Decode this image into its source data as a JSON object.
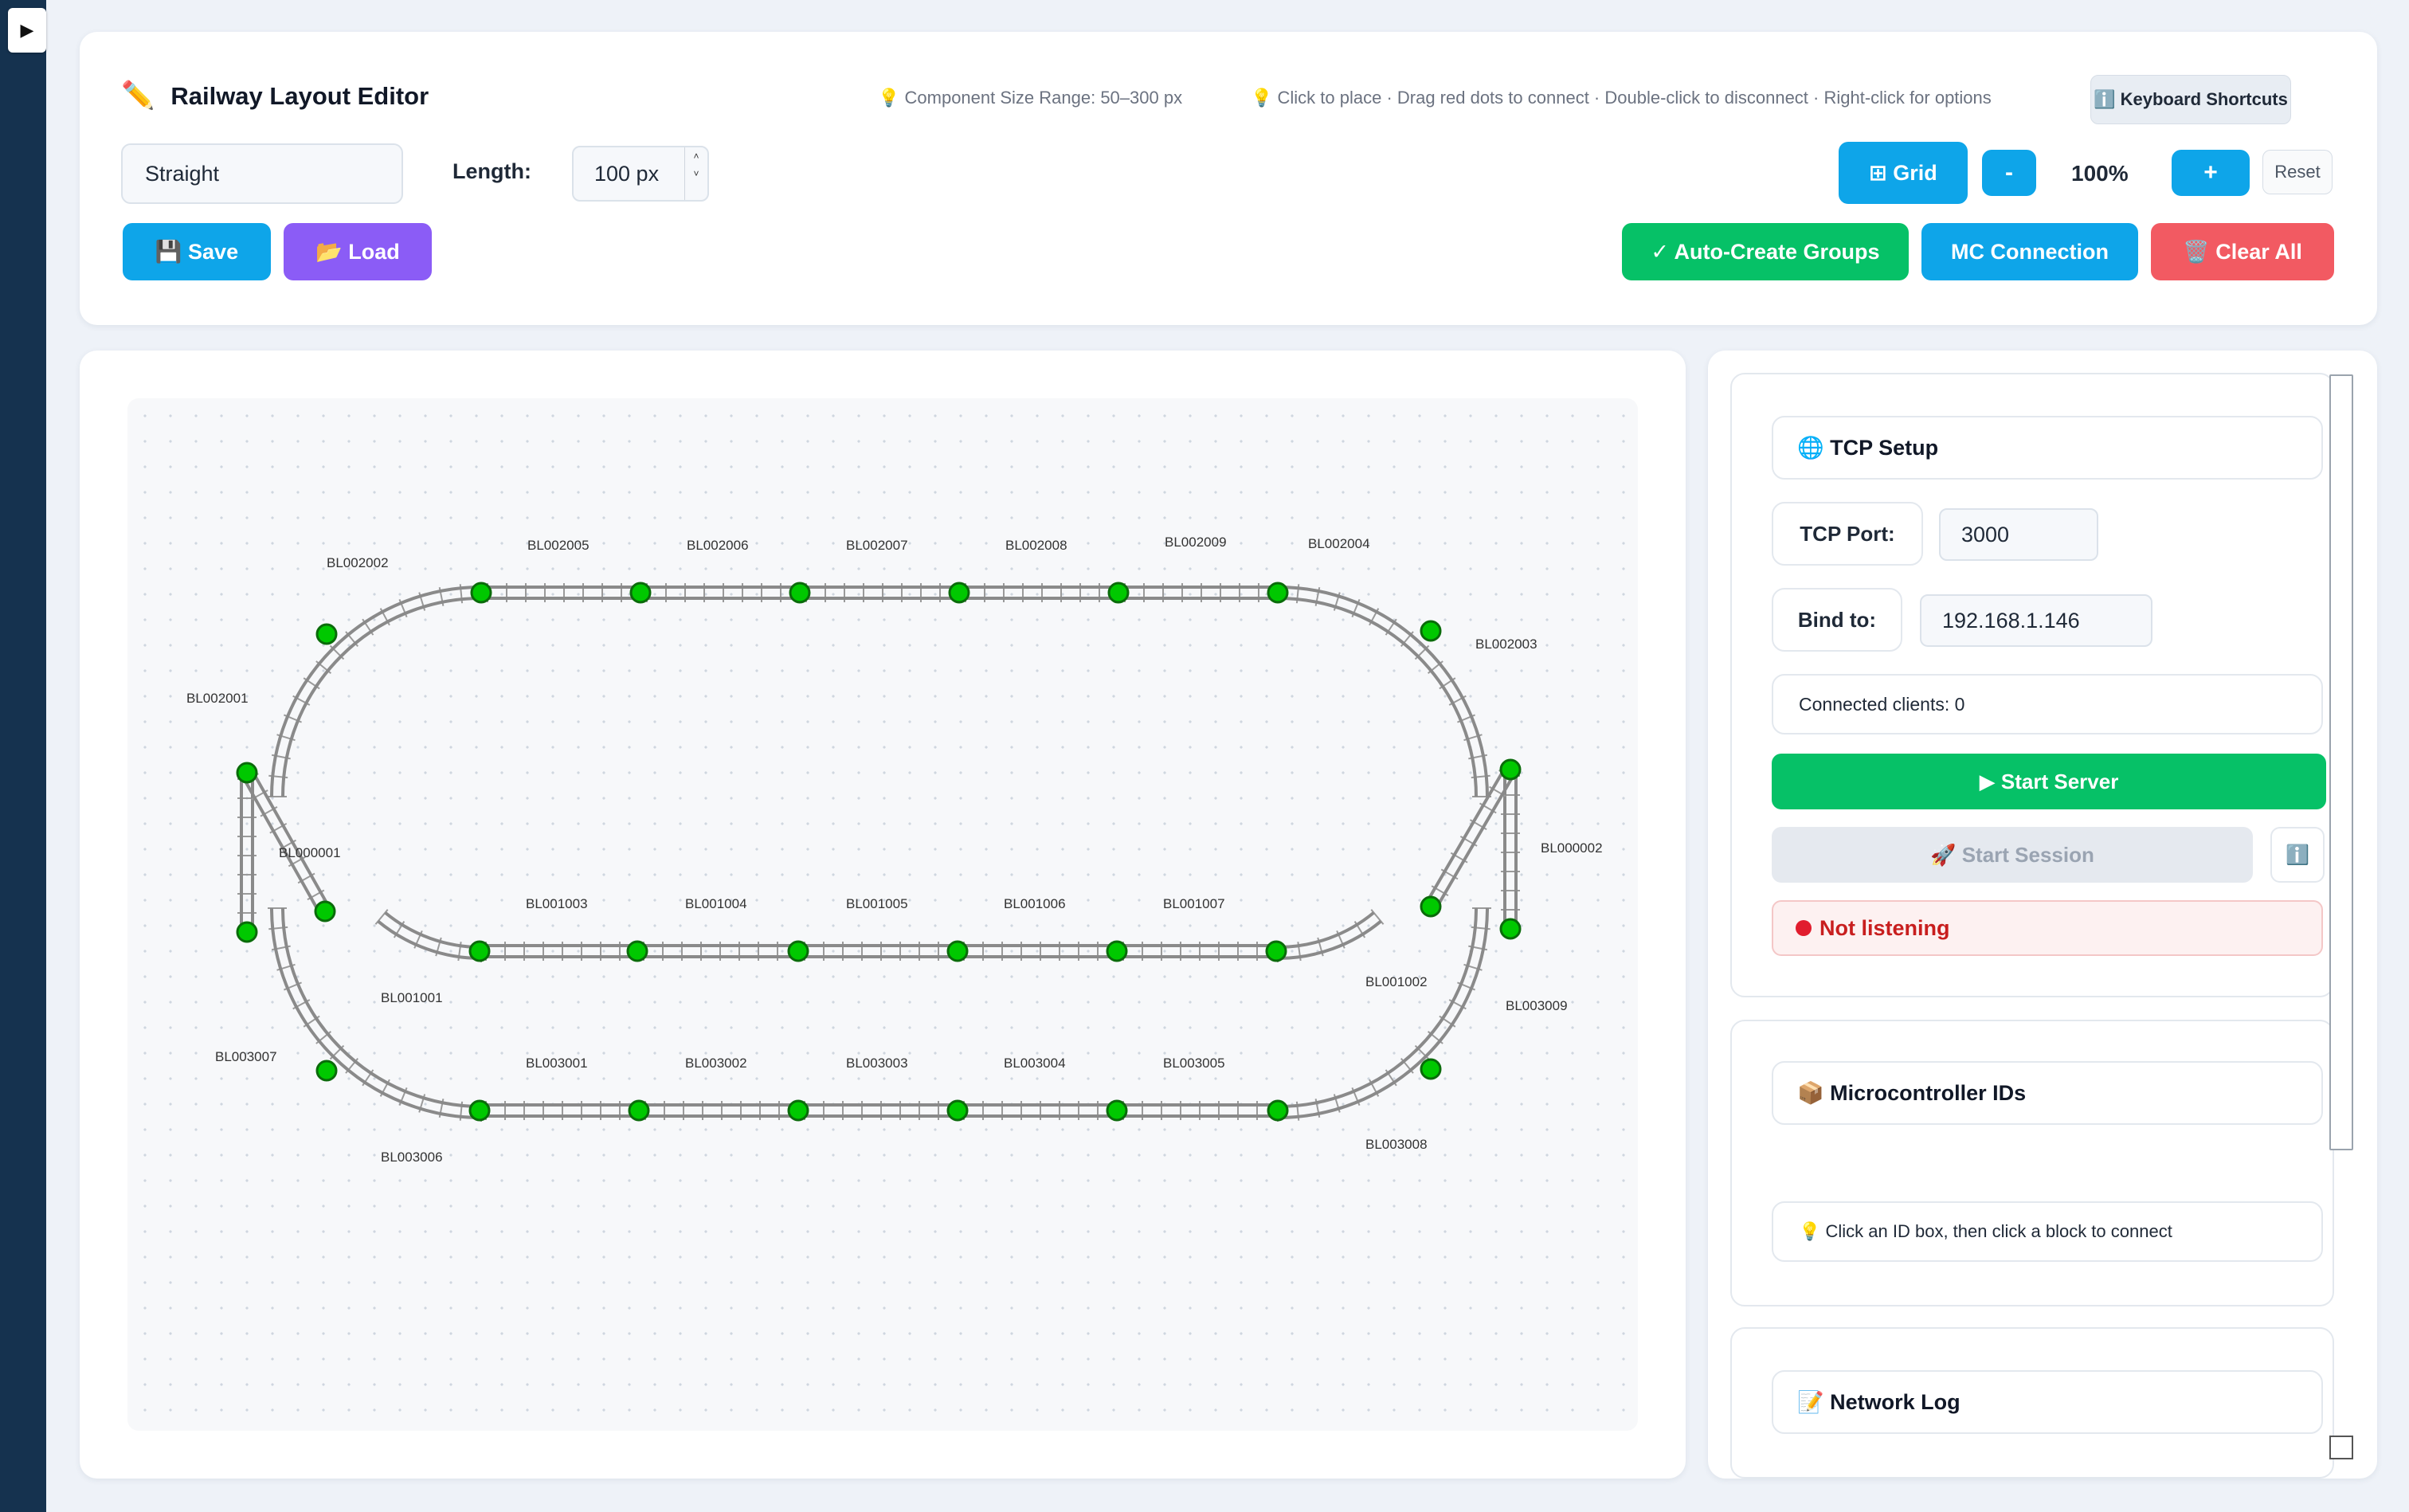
{
  "sidebar": {
    "toggle_icon": "▶"
  },
  "header": {
    "pencil_icon": "✏️",
    "title": "Railway Layout Editor",
    "size_hint": "💡 Component Size Range: 50–300 px",
    "usage_hint": "💡 Click to place · Drag red dots to connect · Double-click to disconnect · Right-click for options",
    "shortcuts_label": "ℹ️ Keyboard Shortcuts"
  },
  "toolbar": {
    "component_type": "Straight",
    "length_label": "Length:",
    "length_value": "100 px",
    "spin_up": "˄",
    "spin_down": "˅",
    "save_label": "💾 Save",
    "load_label": "📂 Load",
    "grid_label": "⊞ Grid",
    "zoom_out_label": "-",
    "zoom_level": "100%",
    "zoom_in_label": "+",
    "reset_label": "Reset",
    "auto_groups_label": "✓ Auto-Create Groups",
    "mc_connection_label": "MC Connection",
    "clear_all_label": "🗑️ Clear All"
  },
  "colors": {
    "accent_blue": "#0ea5e9",
    "purple": "#8b5cf6",
    "green": "#06c167",
    "red": "#f25a62",
    "track": "#8a8a8a",
    "node": "#00c800"
  },
  "layout_blocks": {
    "top_row": [
      "BL002002",
      "BL002005",
      "BL002006",
      "BL002007",
      "BL002008",
      "BL002009",
      "BL002004",
      "BL002003"
    ],
    "left": [
      "BL002001",
      "BL000001",
      "BL003007"
    ],
    "right": [
      "BL000002",
      "BL003009"
    ],
    "middle_row": [
      "BL001003",
      "BL001004",
      "BL001005",
      "BL001006",
      "BL001007",
      "BL001002",
      "BL001001"
    ],
    "bottom_row": [
      "BL003001",
      "BL003002",
      "BL003003",
      "BL003004",
      "BL003005",
      "BL003006",
      "BL003008"
    ]
  },
  "tcp": {
    "heading": "🌐 TCP Setup",
    "port_label": "TCP Port:",
    "port_value": "3000",
    "bind_label": "Bind to:",
    "bind_value": "192.168.1.146",
    "clients_text": "Connected clients: 0",
    "start_server_label": "▶ Start Server",
    "start_session_label": "🚀 Start Session",
    "info_icon": "ℹ️",
    "status_text": "Not listening"
  },
  "microcontrollers": {
    "heading": "📦 Microcontroller IDs",
    "hint": "💡 Click an ID box, then click a block to connect"
  },
  "network_log": {
    "heading": "📝 Network Log"
  }
}
